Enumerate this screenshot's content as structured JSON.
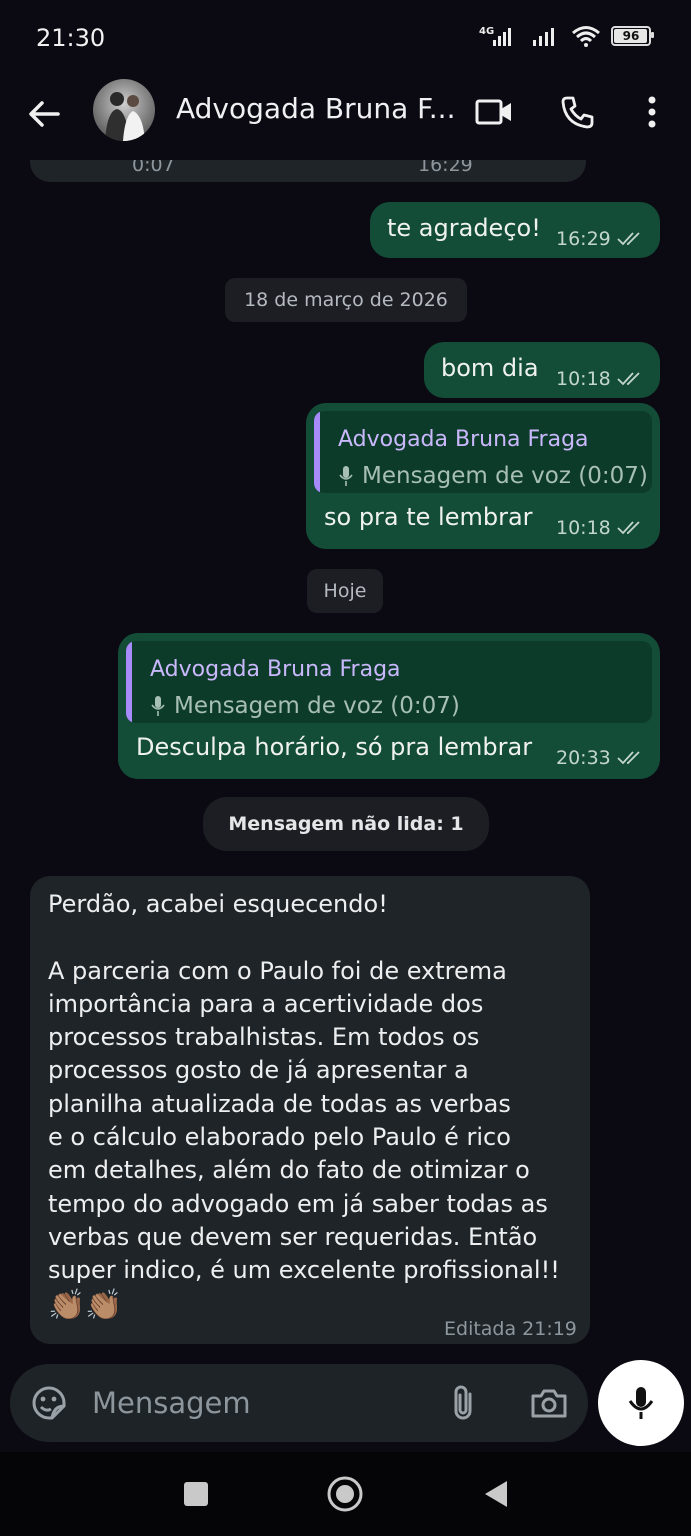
{
  "status_bar": {
    "time": "21:30",
    "network": "4G",
    "battery": "96",
    "battery_level": 0.96
  },
  "header": {
    "contact_name": "Advogada Bruna F..."
  },
  "chat": {
    "prev_message": {
      "duration": "0:07",
      "time": "16:29"
    },
    "msg_thanks": {
      "text": "te agradeço!",
      "time": "16:29"
    },
    "date_1": "18 de março de 2026",
    "msg_bomdia": {
      "text": "bom dia",
      "time": "10:18"
    },
    "msg_reminder_1": {
      "quote_name": "Advogada Bruna Fraga",
      "quote_text": "Mensagem de voz (0:07)",
      "text": "so pra te lembrar",
      "time": "10:18"
    },
    "date_2": "Hoje",
    "msg_reminder_2": {
      "quote_name": "Advogada Bruna Fraga",
      "quote_text": "Mensagem de voz (0:07)",
      "text": "Desculpa horário, só pra lembrar",
      "time": "20:33"
    },
    "unread_banner": "Mensagem não lida: 1",
    "incoming": {
      "text": "Perdão, acabei esquecendo!\n\nA parceria com o Paulo foi de extrema\nimportância para a acertividade dos\nprocessos trabalhistas. Em todos os\nprocessos gosto de já apresentar a\nplanilha atualizada de todas as verbas\ne o cálculo elaborado pelo Paulo é rico\nem detalhes, além do fato de otimizar o\ntempo do advogado em já saber todas as\nverbas que devem ser requeridas. Então\nsuper indico, é um excelente profissional!!",
      "emoji": "👏🏽👏🏽",
      "edited_label": "Editada",
      "time": "21:19"
    }
  },
  "composer": {
    "placeholder": "Mensagem"
  },
  "colors": {
    "outgoing_bubble": "#134d37",
    "incoming_bubble": "#1f2428",
    "background": "#0b0a12",
    "quote_accent": "#a78bfa"
  }
}
